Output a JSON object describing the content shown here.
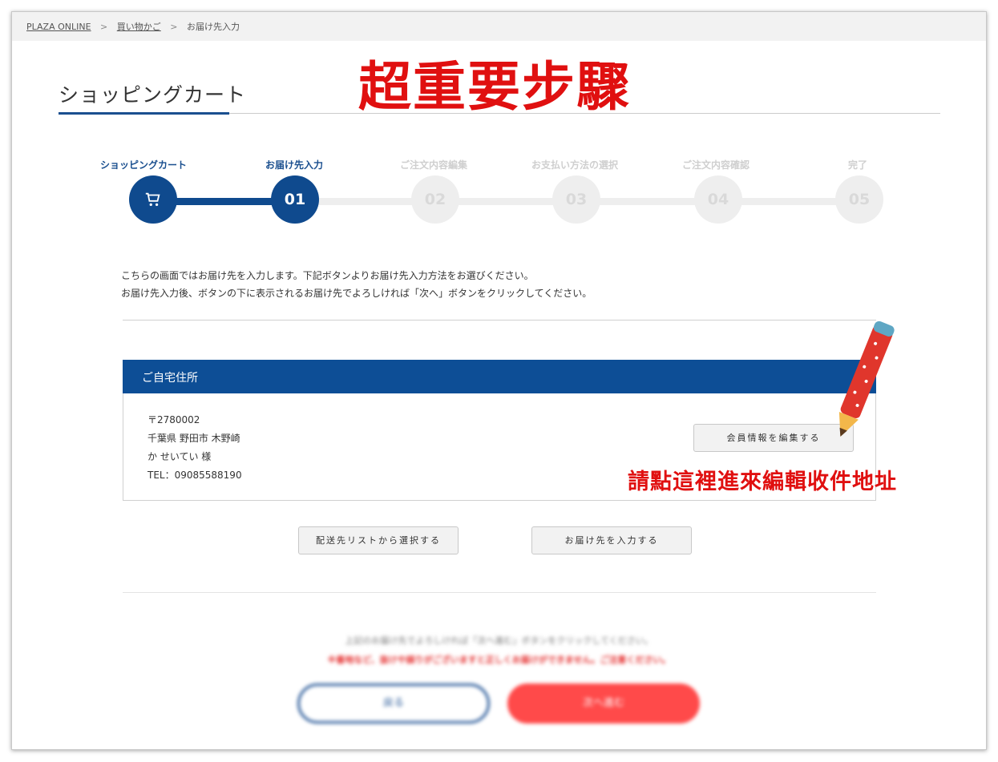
{
  "breadcrumb": {
    "items": [
      {
        "label": "PLAZA ONLINE",
        "link": true
      },
      {
        "label": "買い物かご",
        "link": true
      },
      {
        "label": "お届け先入力",
        "link": false
      }
    ],
    "separator": ">"
  },
  "page_title": "ショッピングカート",
  "overlay_title": "超重要步驟",
  "steps": [
    {
      "label": "ショッピングカート",
      "number": "",
      "icon": "cart-icon",
      "state": "done"
    },
    {
      "label": "お届け先入力",
      "number": "01",
      "state": "current"
    },
    {
      "label": "ご注文内容編集",
      "number": "02",
      "state": "pending"
    },
    {
      "label": "お支払い方法の選択",
      "number": "03",
      "state": "pending"
    },
    {
      "label": "ご注文内容確認",
      "number": "04",
      "state": "pending"
    },
    {
      "label": "完了",
      "number": "05",
      "state": "pending"
    }
  ],
  "intro": {
    "line1": "こちらの画面ではお届け先を入力します。下記ボタンよりお届け先入力方法をお選びください。",
    "line2": "お届け先入力後、ボタンの下に表示されるお届け先でよろしければ「次へ」ボタンをクリックしてください。"
  },
  "address": {
    "header": "ご自宅住所",
    "postal": "〒2780002",
    "line1": "千葉県 野田市 木野崎",
    "name": "か せいてい 様",
    "tel": "TEL：09085588190",
    "edit_button": "会員情報を編集する"
  },
  "annotation": "請點這裡進來編輯收件地址",
  "buttons": {
    "select_from_list": "配送先リストから選択する",
    "enter_address": "お届け先を入力する"
  },
  "footer": {
    "note": "上記のお届け先でよろしければ「次へ進む」ボタンをクリックしてください。",
    "warning": "※番地など、抜けや誤りがございますと正しくお届けができません。ご注意ください。",
    "back_button": "戻る",
    "next_button": "次へ進む"
  },
  "colors": {
    "primary": "#0f4a8e",
    "annotation_red": "#e01010",
    "next_button": "#ff4a4a"
  }
}
